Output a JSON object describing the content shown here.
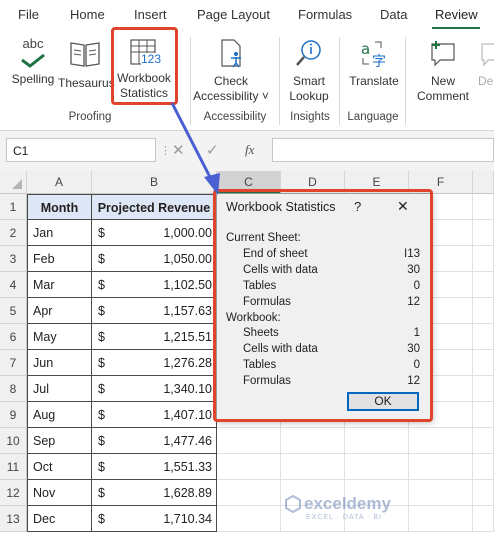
{
  "ribbon_tabs": [
    "File",
    "Home",
    "Insert",
    "Page Layout",
    "Formulas",
    "Data",
    "Review"
  ],
  "buttons": {
    "spelling": {
      "icon_text": "abc",
      "label": "Spelling"
    },
    "thesaurus": {
      "label": "Thesaurus"
    },
    "workbook_stats": {
      "icon_text": "123",
      "label1": "Workbook",
      "label2": "Statistics"
    },
    "check_access": {
      "label1": "Check",
      "label2": "Accessibility ˅"
    },
    "smart_lookup": {
      "label1": "Smart",
      "label2": "Lookup"
    },
    "translate": {
      "label": "Translate"
    },
    "new_comment": {
      "label1": "New",
      "label2": "Comment"
    },
    "delete": {
      "label": "Del"
    }
  },
  "groups": [
    "Proofing",
    "Accessibility",
    "Insights",
    "Language"
  ],
  "name_box": "C1",
  "fx_label": "fx",
  "column_headers": [
    "A",
    "B",
    "C",
    "D",
    "E",
    "F"
  ],
  "rows": [
    {
      "n": "1",
      "a": "Month",
      "b_sym": "",
      "b": "Projected Revenue"
    },
    {
      "n": "2",
      "a": "Jan",
      "b_sym": "$",
      "b": "1,000.00"
    },
    {
      "n": "3",
      "a": "Feb",
      "b_sym": "$",
      "b": "1,050.00"
    },
    {
      "n": "4",
      "a": "Mar",
      "b_sym": "$",
      "b": "1,102.50"
    },
    {
      "n": "5",
      "a": "Apr",
      "b_sym": "$",
      "b": "1,157.63"
    },
    {
      "n": "6",
      "a": "May",
      "b_sym": "$",
      "b": "1,215.51"
    },
    {
      "n": "7",
      "a": "Jun",
      "b_sym": "$",
      "b": "1,276.28"
    },
    {
      "n": "8",
      "a": "Jul",
      "b_sym": "$",
      "b": "1,340.10"
    },
    {
      "n": "9",
      "a": "Aug",
      "b_sym": "$",
      "b": "1,407.10"
    },
    {
      "n": "10",
      "a": "Sep",
      "b_sym": "$",
      "b": "1,477.46"
    },
    {
      "n": "11",
      "a": "Oct",
      "b_sym": "$",
      "b": "1,551.33"
    },
    {
      "n": "12",
      "a": "Nov",
      "b_sym": "$",
      "b": "1,628.89"
    },
    {
      "n": "13",
      "a": "Dec",
      "b_sym": "$",
      "b": "1,710.34"
    }
  ],
  "dialog": {
    "title": "Workbook Statistics",
    "help": "?",
    "close": "✕",
    "current_sheet_label": "Current Sheet:",
    "sheet_items": [
      {
        "label": "End of sheet",
        "value": "I13"
      },
      {
        "label": "Cells with data",
        "value": "30"
      },
      {
        "label": "Tables",
        "value": "0"
      },
      {
        "label": "Formulas",
        "value": "12"
      }
    ],
    "workbook_label": "Workbook:",
    "workbook_items": [
      {
        "label": "Sheets",
        "value": "1"
      },
      {
        "label": "Cells with data",
        "value": "30"
      },
      {
        "label": "Tables",
        "value": "0"
      },
      {
        "label": "Formulas",
        "value": "12"
      }
    ],
    "ok": "OK"
  },
  "watermark": {
    "name": "exceldemy",
    "tagline": "EXCEL · DATA · BI"
  },
  "colors": {
    "header_fill": "#dde7f5",
    "accent_green": "#217346",
    "highlight": "#e0442a",
    "arrow": "#4a5fd1"
  }
}
